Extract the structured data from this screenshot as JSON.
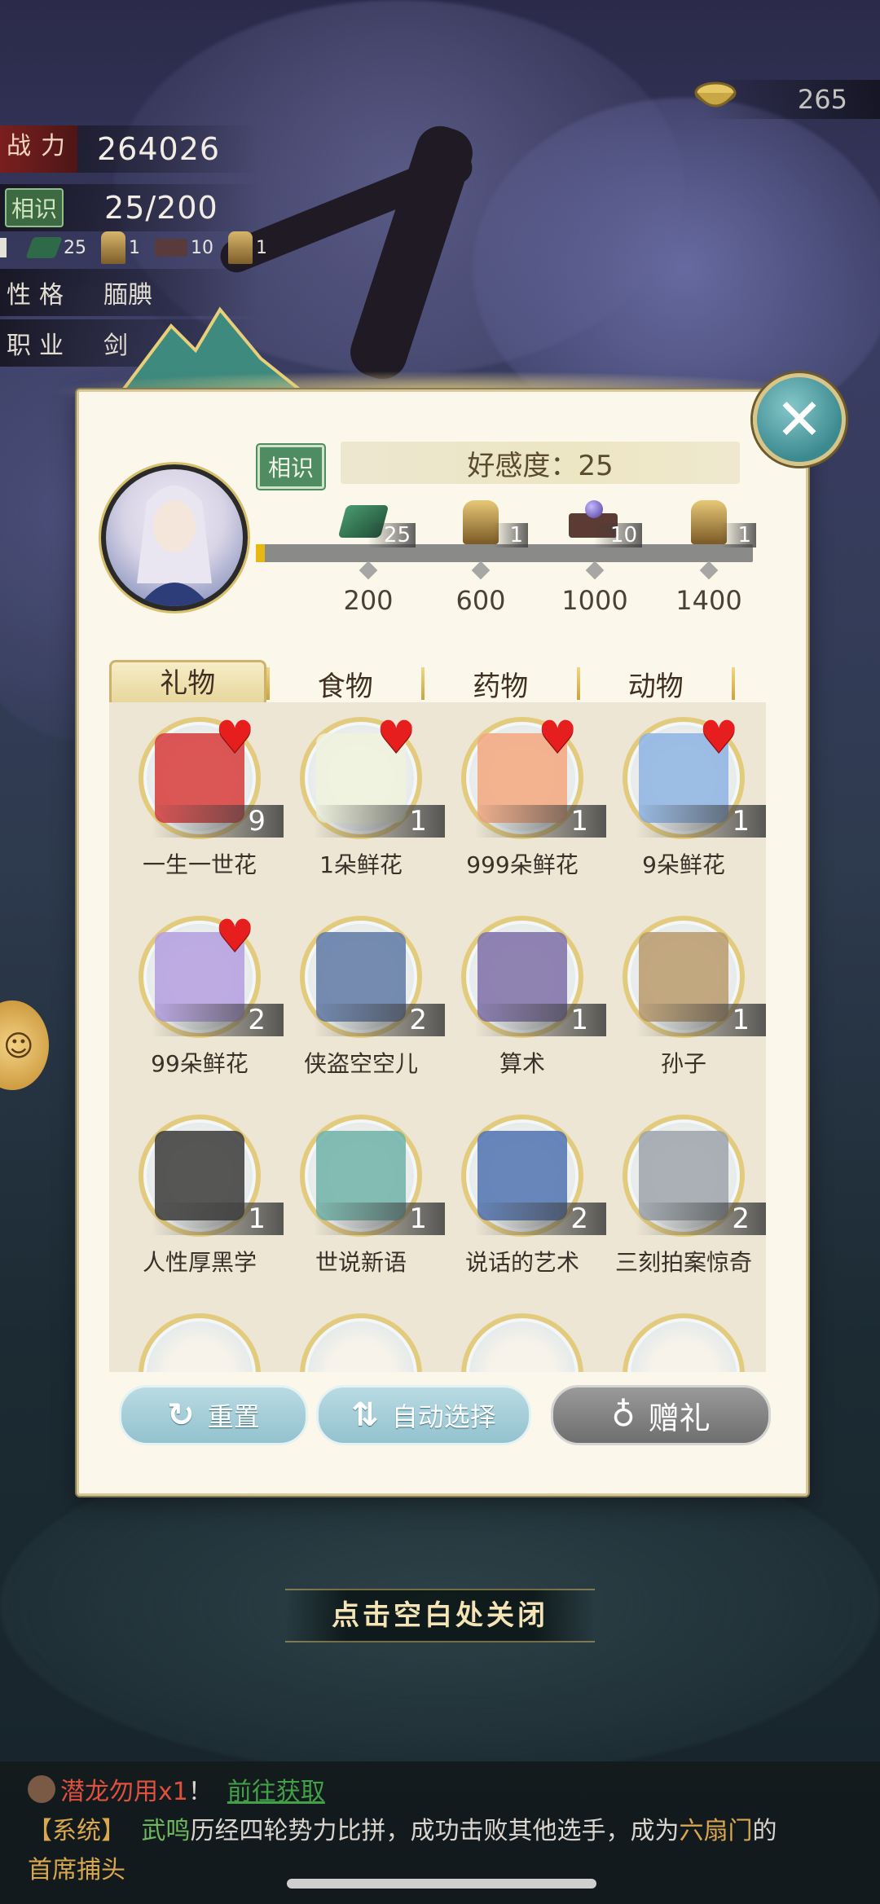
{
  "top_left": {
    "power_label": "战力",
    "power_value": "264026",
    "acquaintance_tag": "相识",
    "acquaintance_progress": "25/200",
    "mini_rewards": [
      "25",
      "1",
      "10",
      "1"
    ],
    "personality_label": "性格",
    "personality_value": "腼腆",
    "job_label": "职业",
    "job_value": "剑"
  },
  "currency": {
    "icon": "bowl-icon",
    "value": "265"
  },
  "panel": {
    "relation_tag": "相识",
    "affection_text": "好感度：25",
    "progress": {
      "value": 25,
      "max": 1400,
      "fill_fraction": 0.0179
    },
    "milestones": [
      {
        "reward_count": "25",
        "value": "200",
        "icon": "jade-stone-icon"
      },
      {
        "reward_count": "1",
        "value": "600",
        "icon": "gold-rock-icon"
      },
      {
        "reward_count": "10",
        "value": "1000",
        "icon": "pearl-box-icon"
      },
      {
        "reward_count": "1",
        "value": "1400",
        "icon": "gold-rock-icon"
      }
    ],
    "tabs": [
      "礼物",
      "食物",
      "药物",
      "动物"
    ],
    "active_tab": "礼物",
    "items": [
      {
        "name": "一生一世花",
        "qty": "9",
        "heart": true,
        "color": "#d63b3b"
      },
      {
        "name": "1朵鲜花",
        "qty": "1",
        "heart": true,
        "color": "#eef2dd"
      },
      {
        "name": "999朵鲜花",
        "qty": "1",
        "heart": true,
        "color": "#f2a77f"
      },
      {
        "name": "9朵鲜花",
        "qty": "1",
        "heart": true,
        "color": "#8cb3e3"
      },
      {
        "name": "99朵鲜花",
        "qty": "2",
        "heart": true,
        "color": "#b39ee0"
      },
      {
        "name": "侠盗空空儿",
        "qty": "2",
        "heart": false,
        "color": "#5e79a6"
      },
      {
        "name": "算术",
        "qty": "1",
        "heart": false,
        "color": "#7d6fa8"
      },
      {
        "name": "孙子",
        "qty": "1",
        "heart": false,
        "color": "#b89a6c"
      },
      {
        "name": "人性厚黑学",
        "qty": "1",
        "heart": false,
        "color": "#3a3a3a"
      },
      {
        "name": "世说新语",
        "qty": "1",
        "heart": false,
        "color": "#6fb1a8"
      },
      {
        "name": "说话的艺术",
        "qty": "2",
        "heart": false,
        "color": "#4f72b0"
      },
      {
        "name": "三刻拍案惊奇",
        "qty": "2",
        "heart": false,
        "color": "#9ca3ac"
      }
    ],
    "buttons": {
      "reset": "重置",
      "auto_select": "自动选择",
      "gift": "赠礼"
    }
  },
  "close_hint": "点击空白处关闭",
  "bottom_message": {
    "line1_item": "潜龙勿用x1",
    "line1_bang": "！",
    "line1_link": "前往获取",
    "system_tag": "【系统】",
    "name": "武鸣",
    "text_a": "历经四轮势力比拼，成功击败其他选手，成为",
    "highlight": "六扇门",
    "text_b": "的",
    "line3": "首席捕头"
  }
}
